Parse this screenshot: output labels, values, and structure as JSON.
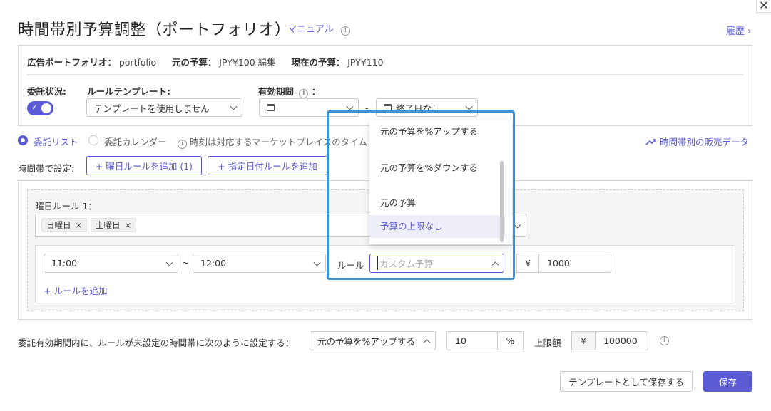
{
  "header": {
    "title": "時間帯別予算調整（ポートフォリオ）",
    "manual": "マニュアル",
    "history": "履歴 ›",
    "close": "✕"
  },
  "summary": {
    "portfolio_label": "広告ポートフォリオ：",
    "portfolio_value": "portfolio",
    "original_budget_label": "元の予算：",
    "original_budget_value": "JPY¥100",
    "edit": "編集",
    "current_budget_label": "現在の予算：",
    "current_budget_value": "JPY¥110"
  },
  "settings": {
    "delegation_label": "委託状況:",
    "delegation_on": true,
    "template_label": "ルールテンプレート:",
    "template_value": "テンプレートを使用しません",
    "period_label": "有効期間",
    "period_colon": "：",
    "period_dash": "-",
    "end_date": "終了日なし"
  },
  "view": {
    "list": "委託リスト",
    "calendar": "委託カレンダー",
    "note": "時刻は対応するマーケットプレイスのタイム",
    "sales_data": "時間帯別の販売データ"
  },
  "time_setting": {
    "label": "時間帯で設定:",
    "add_weekday": "+ 曜日ルールを追加 (1)",
    "add_date": "+ 指定日付ルールを追加"
  },
  "weekday_rule": {
    "title": "曜日ルール 1：",
    "days": [
      "日曜日",
      "土曜日"
    ],
    "chip_close": "×",
    "start_time": "11:00",
    "tilde": "~",
    "end_time": "12:00",
    "rule_label": "ルール",
    "rule_placeholder": "カスタム予算",
    "currency": "¥",
    "amount": "1000",
    "add_rule": "+ ルールを追加"
  },
  "dropdown": {
    "options": [
      "元の予算を%アップする",
      "元の予算を%ダウンする",
      "元の予算",
      "予算の上限なし"
    ],
    "active_index": 3
  },
  "footer": {
    "unset_label": "委託有効期間内に、ルールが未設定の時間帯に次のように設定する：",
    "unset_value": "元の予算を%アップする",
    "percent_value": "10",
    "percent": "%",
    "cap_label": "上限額",
    "cap_currency": "¥",
    "cap_value": "100000",
    "save_template": "テンプレートとして保存する",
    "save": "保存"
  },
  "colors": {
    "accent": "#5b5bd6",
    "highlight": "#3b95dc"
  }
}
